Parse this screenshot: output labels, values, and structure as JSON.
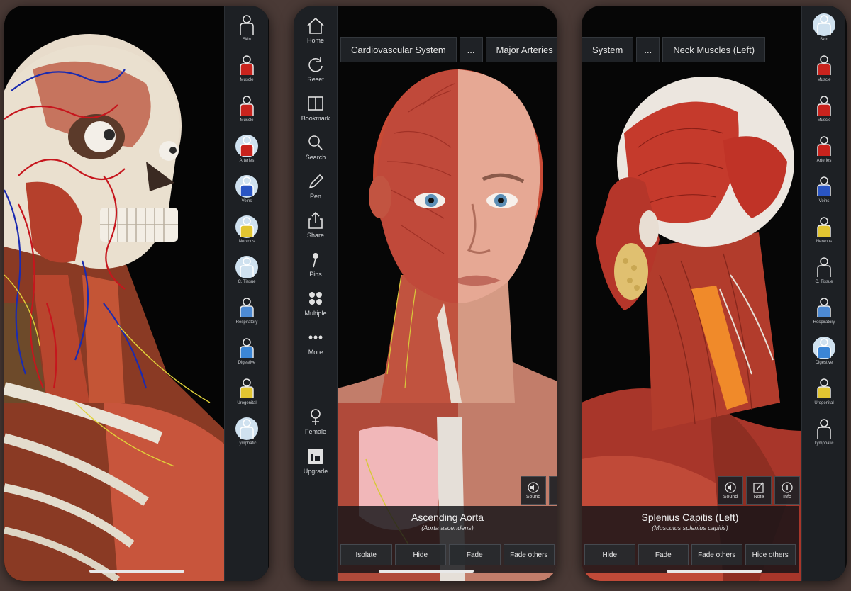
{
  "screens": {
    "left": {
      "rail": [
        {
          "label": "Skin",
          "icon": "skin-figure-icon",
          "active": false
        },
        {
          "label": "Muscle",
          "icon": "muscle-figure-icon",
          "active": false
        },
        {
          "label": "Muscle",
          "icon": "muscle-figure-icon",
          "active": false
        },
        {
          "label": "Arteries",
          "icon": "arteries-icon",
          "active": true
        },
        {
          "label": "Veins",
          "icon": "veins-icon",
          "active": true
        },
        {
          "label": "Nervous",
          "icon": "nervous-icon",
          "active": true
        },
        {
          "label": "C. Tissue",
          "icon": "tissue-icon",
          "active": true
        },
        {
          "label": "Respiratory",
          "icon": "respiratory-icon",
          "active": false
        },
        {
          "label": "Digestive",
          "icon": "digestive-icon",
          "active": false
        },
        {
          "label": "Urogenital",
          "icon": "urogenital-icon",
          "active": false
        },
        {
          "label": "Lymphatic",
          "icon": "lymphatic-icon",
          "active": true
        }
      ]
    },
    "middle": {
      "nav": [
        {
          "label": "Home",
          "icon": "home-icon"
        },
        {
          "label": "Reset",
          "icon": "reset-icon"
        },
        {
          "label": "Bookmark",
          "icon": "bookmark-icon"
        },
        {
          "label": "Search",
          "icon": "search-icon"
        },
        {
          "label": "Pen",
          "icon": "pen-icon"
        },
        {
          "label": "Share",
          "icon": "share-icon"
        },
        {
          "label": "Pins",
          "icon": "pin-icon"
        },
        {
          "label": "Multiple",
          "icon": "multiple-icon"
        },
        {
          "label": "More",
          "icon": "more-icon"
        }
      ],
      "bottom_nav": [
        {
          "label": "Female",
          "icon": "female-icon"
        },
        {
          "label": "Upgrade",
          "icon": "upgrade-icon"
        }
      ],
      "breadcrumb": [
        "Cardiovascular System",
        "...",
        "Major Arteries"
      ],
      "tools": [
        {
          "label": "Sound",
          "icon": "sound-icon"
        }
      ],
      "selection": {
        "title": "Ascending Aorta",
        "latin": "(Aorta ascendens)",
        "buttons": [
          "Isolate",
          "Hide",
          "Fade",
          "Fade others"
        ]
      }
    },
    "right": {
      "breadcrumb": [
        "System",
        "...",
        "Neck Muscles (Left)"
      ],
      "tools": [
        {
          "label": "Sound",
          "icon": "sound-icon"
        },
        {
          "label": "Note",
          "icon": "note-icon"
        },
        {
          "label": "Info",
          "icon": "info-icon"
        }
      ],
      "selection": {
        "title": "Splenius Capitis (Left)",
        "latin": "(Musculus splenius capitis)",
        "buttons": [
          "Hide",
          "Fade",
          "Fade others",
          "Hide others"
        ]
      },
      "rail": [
        {
          "label": "Skin",
          "icon": "skin-figure-icon",
          "active": true
        },
        {
          "label": "Muscle",
          "icon": "muscle-figure-icon",
          "active": false
        },
        {
          "label": "Muscle",
          "icon": "muscle-figure-icon",
          "active": false
        },
        {
          "label": "Arteries",
          "icon": "arteries-icon",
          "active": false
        },
        {
          "label": "Veins",
          "icon": "veins-icon",
          "active": false
        },
        {
          "label": "Nervous",
          "icon": "nervous-icon",
          "active": false
        },
        {
          "label": "C. Tissue",
          "icon": "tissue-icon",
          "active": false
        },
        {
          "label": "Respiratory",
          "icon": "respiratory-icon",
          "active": false
        },
        {
          "label": "Digestive",
          "icon": "digestive-icon",
          "active": true
        },
        {
          "label": "Urogenital",
          "icon": "urogenital-icon",
          "active": false
        },
        {
          "label": "Lymphatic",
          "icon": "lymphatic-icon",
          "active": false
        }
      ]
    }
  },
  "colors": {
    "panel": "#1d2024",
    "active_circle": "#cfe1ef",
    "muscle_red": "#b52a22",
    "bone": "#e7ddcc"
  }
}
